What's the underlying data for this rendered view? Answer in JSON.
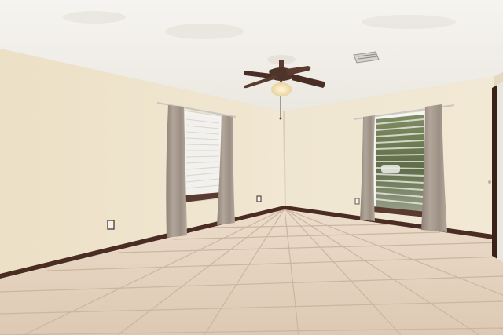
{
  "scene": {
    "subject": "empty-room-interior",
    "colors": {
      "ceiling": "#f3f1ec",
      "wall_left": "#ece1c8",
      "wall_back": "#f1e8d3",
      "wall_right": "#efe5cf",
      "floor_tile": "#e3d2bf",
      "grout": "#cdb9a3",
      "baseboard": "#4a2c22",
      "curtain": "#a89b90",
      "curtain_shadow": "#8a7d72",
      "blind": "#f2f1ee",
      "window_frame": "#f7f6f2",
      "fan_blade": "#4a2e25",
      "fan_light": "#f4e7c5"
    },
    "objects": [
      "ceiling-fan",
      "air-vent",
      "left-window",
      "right-window",
      "four-curtain-panels",
      "wall-outlets",
      "door-edge",
      "tiled-floor"
    ]
  }
}
